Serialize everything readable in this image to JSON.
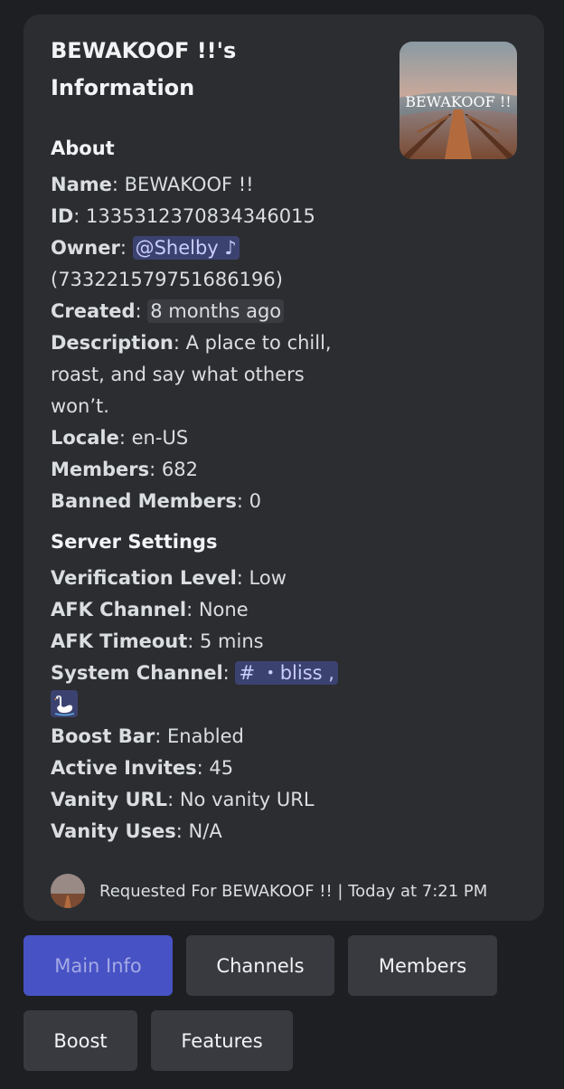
{
  "embed": {
    "title": "BEWAKOOF !!'s Information",
    "thumbnail_text": "BEWAKOOF !!",
    "about": {
      "heading": "About",
      "name_label": "Name",
      "name_value": "BEWAKOOF !!",
      "id_label": "ID",
      "id_value": "1335312370834346015",
      "owner_label": "Owner",
      "owner_mention": "@Shelby ♪",
      "owner_id": "(733221579751686196)",
      "created_label": "Created",
      "created_value": "8 months ago",
      "description_label": "Description",
      "description_value": "A place to chill, roast, and say what others won’t.",
      "locale_label": "Locale",
      "locale_value": "en-US",
      "members_label": "Members",
      "members_value": "682",
      "banned_label": "Banned Members",
      "banned_value": "0"
    },
    "settings": {
      "heading": "Server Settings",
      "verification_label": "Verification Level",
      "verification_value": "Low",
      "afk_channel_label": "AFK Channel",
      "afk_channel_value": "None",
      "afk_timeout_label": "AFK Timeout",
      "afk_timeout_value": "5 mins",
      "system_channel_label": "System Channel",
      "system_channel_value": "# ・bliss ,",
      "boost_bar_label": "Boost Bar",
      "boost_bar_value": "Enabled",
      "active_invites_label": "Active Invites",
      "active_invites_value": "45",
      "vanity_url_label": "Vanity URL",
      "vanity_url_value": "No vanity URL",
      "vanity_uses_label": "Vanity Uses",
      "vanity_uses_value": "N/A"
    },
    "footer": "Requested For BEWAKOOF !! | Today at 7:21 PM"
  },
  "buttons": {
    "main_info": "Main Info",
    "channels": "Channels",
    "members": "Members",
    "boost": "Boost",
    "features": "Features"
  },
  "colors": {
    "background": "#1e1f22",
    "embed": "#2b2d31",
    "mention_bg": "#3c4270",
    "active_button": "#4752c4",
    "button": "#383a40"
  }
}
